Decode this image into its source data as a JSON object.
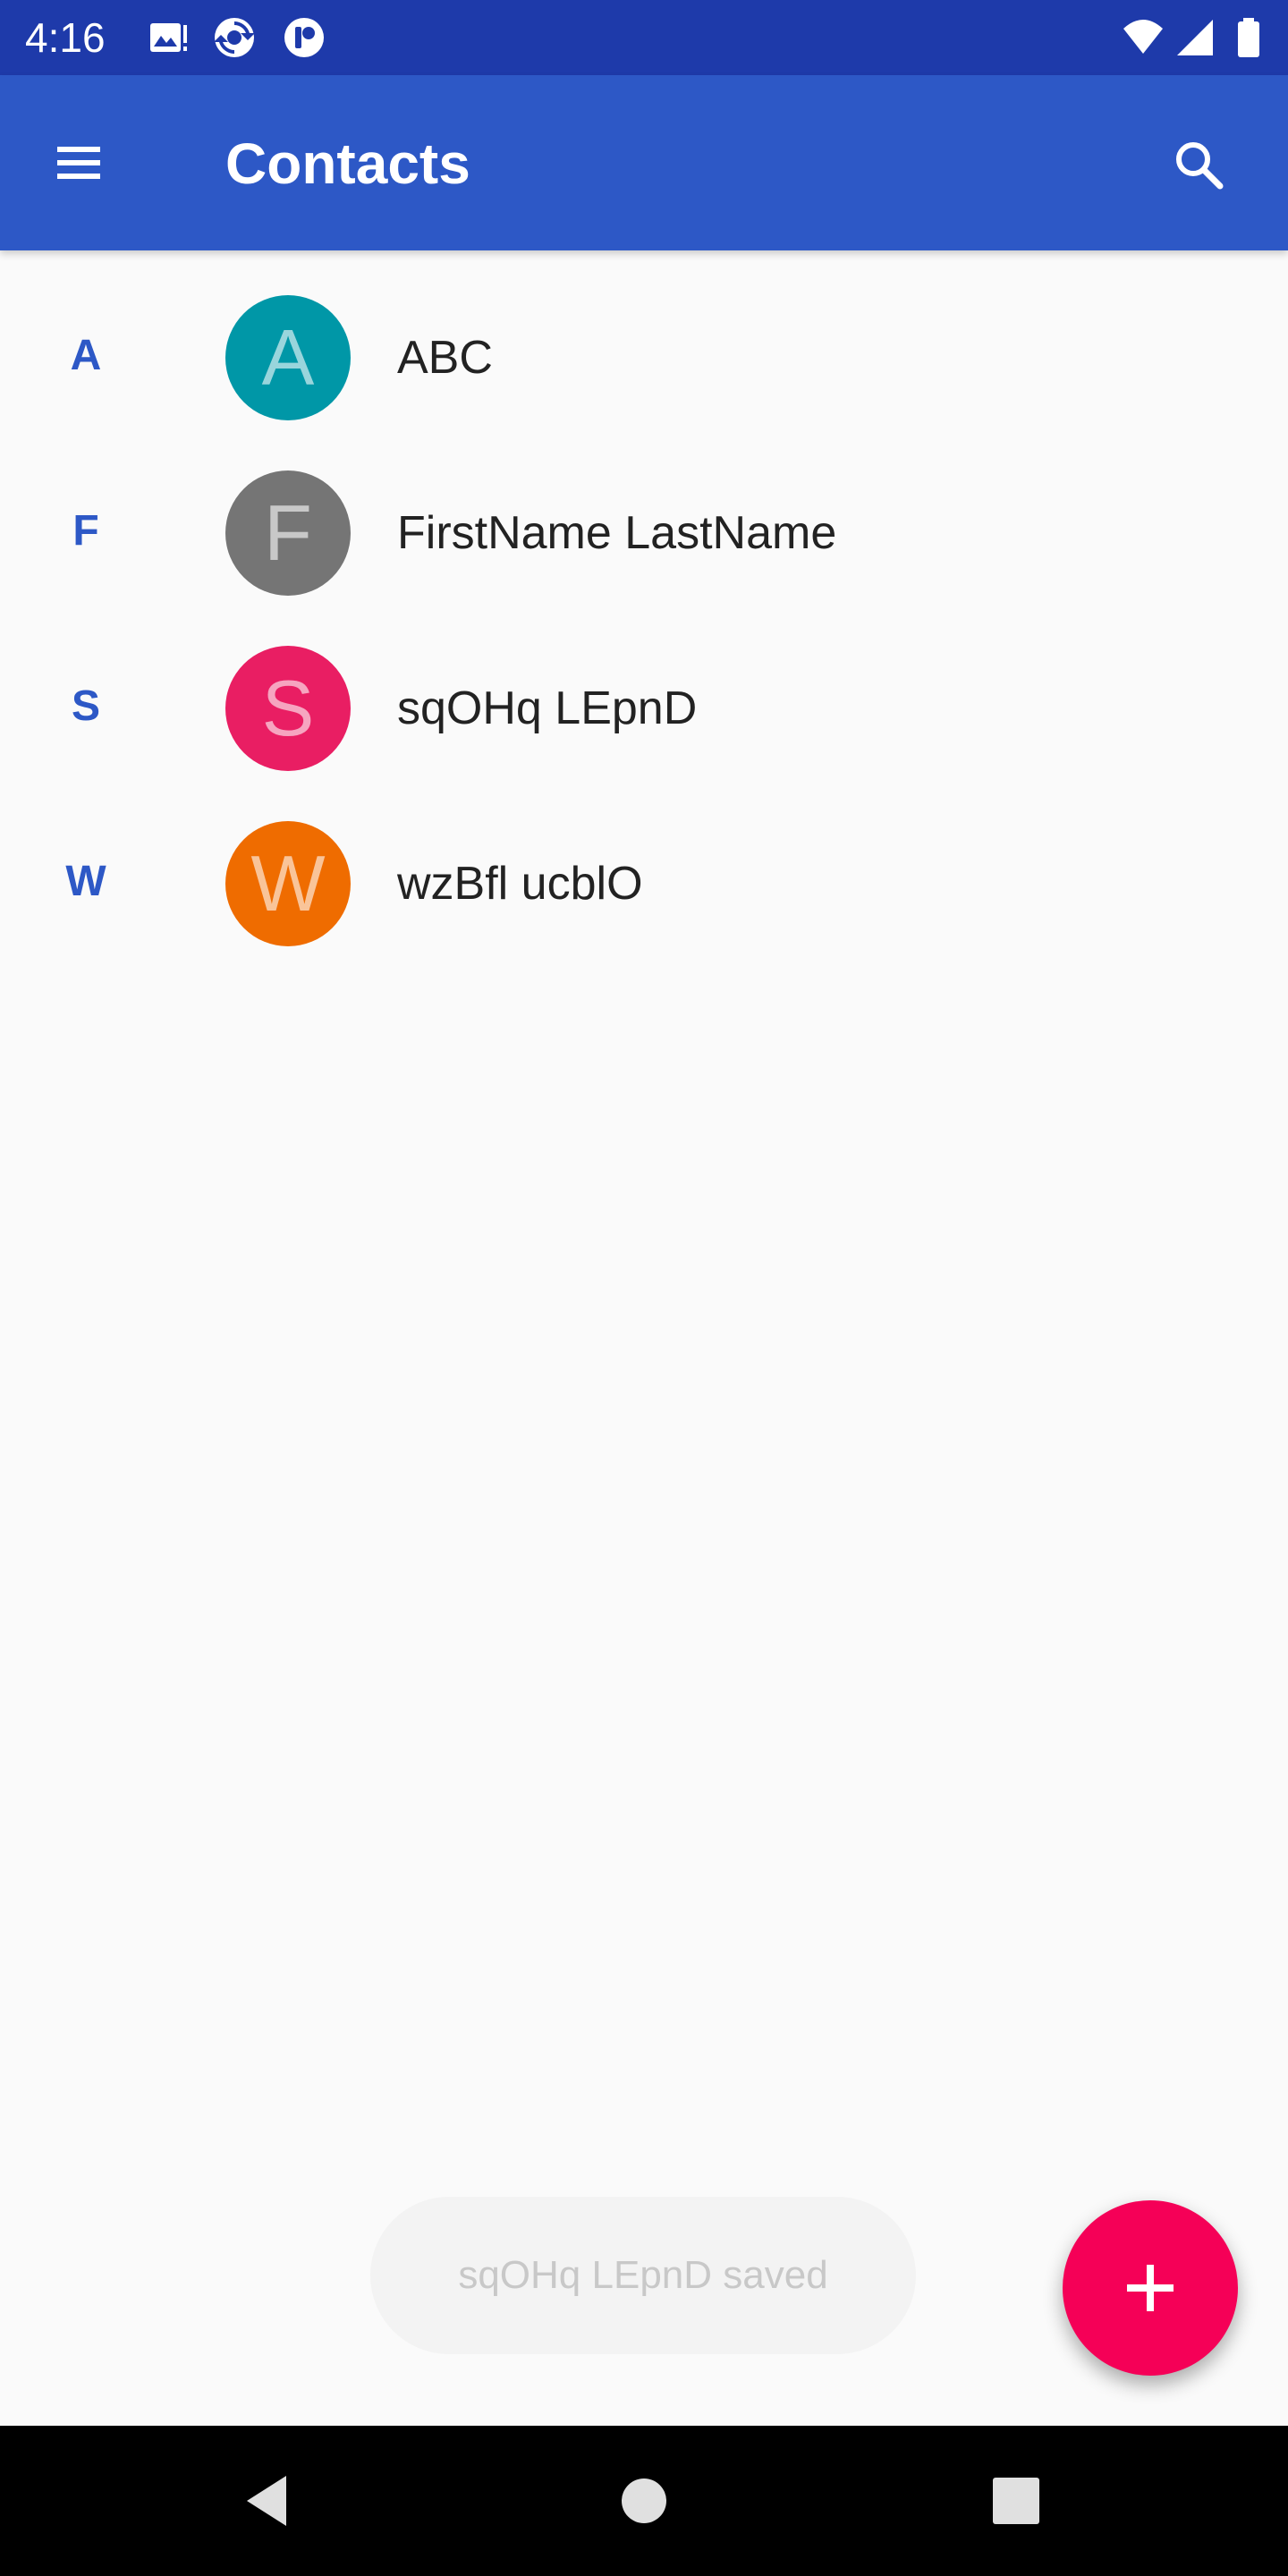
{
  "status_bar": {
    "time": "4:16",
    "icons": [
      "image-notification-icon",
      "sync-icon",
      "app-notification-icon",
      "wifi-icon",
      "cellular-signal-icon",
      "battery-icon"
    ]
  },
  "app_bar": {
    "title": "Contacts",
    "color": "#2d58c6",
    "icons": [
      "menu-icon",
      "search-icon"
    ]
  },
  "contacts": [
    {
      "section": "A",
      "initial": "A",
      "name": "ABC",
      "color": "#0097a7"
    },
    {
      "section": "F",
      "initial": "F",
      "name": "FirstName LastName",
      "color": "#757575"
    },
    {
      "section": "S",
      "initial": "S",
      "name": "sqOHq LEpnD",
      "color": "#e91e63"
    },
    {
      "section": "W",
      "initial": "W",
      "name": "wzBfl ucblO",
      "color": "#ef6c00"
    }
  ],
  "snackbar": {
    "text": "sqOHq LEpnD saved"
  },
  "fab": {
    "icon": "add-icon",
    "color": "#f50057"
  },
  "nav_bar": {
    "icons": [
      "back-icon",
      "home-icon",
      "recents-icon"
    ]
  }
}
